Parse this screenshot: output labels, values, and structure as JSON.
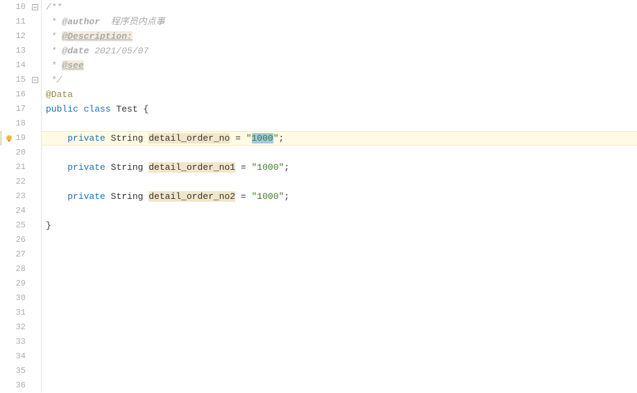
{
  "gutter": {
    "start": 10,
    "end": 36
  },
  "code": {
    "l10": {
      "open": "/**"
    },
    "l11": {
      "star": " * ",
      "tag": "@author",
      "text": "  程序员内点事"
    },
    "l12": {
      "star": " * ",
      "tag": "@Description:"
    },
    "l13": {
      "star": " * ",
      "tag": "@date",
      "text": " 2021/05/07"
    },
    "l14": {
      "star": " * ",
      "tag": "@see"
    },
    "l15": {
      "close": " */"
    },
    "l16": {
      "anno": "@Data"
    },
    "l17": {
      "kw1": "public ",
      "kw2": "class ",
      "name": "Test ",
      "brace": "{"
    },
    "l19": {
      "indent": "    ",
      "kw": "private ",
      "type": "String ",
      "field": "detail_order_no",
      "eq": " = ",
      "q1": "\"",
      "val": "1000",
      "q2": "\"",
      "semi": ";"
    },
    "l21": {
      "indent": "    ",
      "kw": "private ",
      "type": "String ",
      "field": "detail_order_no1",
      "eq": " = ",
      "q1": "\"",
      "val": "1000",
      "q2": "\"",
      "semi": ";"
    },
    "l23": {
      "indent": "    ",
      "kw": "private ",
      "type": "String ",
      "field": "detail_order_no2",
      "eq": " = ",
      "q1": "\"",
      "val": "1000",
      "q2": "\"",
      "semi": ";"
    },
    "l25": {
      "brace": "}"
    }
  },
  "icons": {
    "fold_open": "⊟",
    "fold_close": "⊟"
  }
}
